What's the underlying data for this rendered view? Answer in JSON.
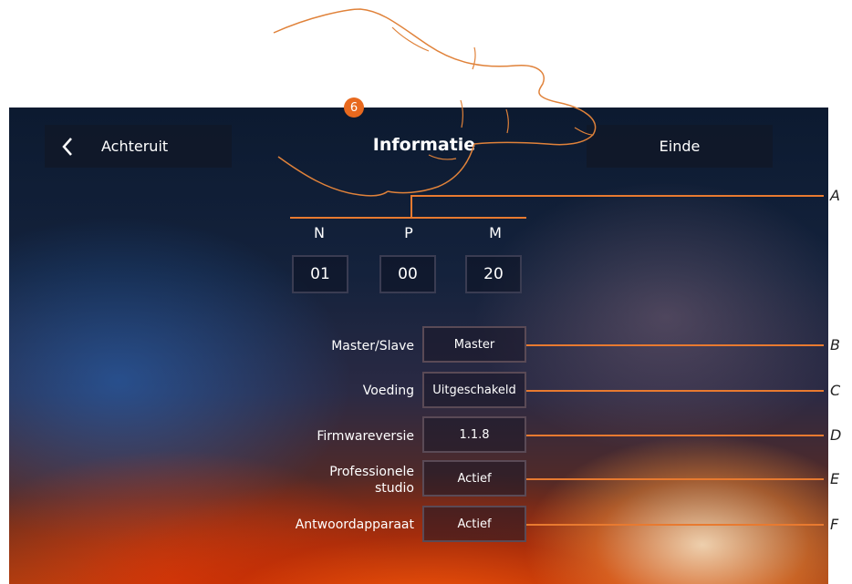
{
  "header": {
    "back_label": "Achteruit",
    "title": "Informatie",
    "end_label": "Einde"
  },
  "address": {
    "labels": [
      "N",
      "P",
      "M"
    ],
    "values": [
      "01",
      "00",
      "20"
    ]
  },
  "rows": [
    {
      "label": "Master/Slave",
      "value": "Master"
    },
    {
      "label": "Voeding",
      "value": "Uitgeschakeld"
    },
    {
      "label": "Firmwareversie",
      "value": "1.1.8"
    },
    {
      "label_line1": "Professionele",
      "label_line2": "studio",
      "value": "Actief"
    },
    {
      "label": "Antwoordapparaat",
      "value": "Actief"
    }
  ],
  "callouts": [
    "A",
    "B",
    "C",
    "D",
    "E",
    "F"
  ],
  "step_badge": "6",
  "colors": {
    "accent": "#e87a30",
    "badge": "#e8691e"
  }
}
